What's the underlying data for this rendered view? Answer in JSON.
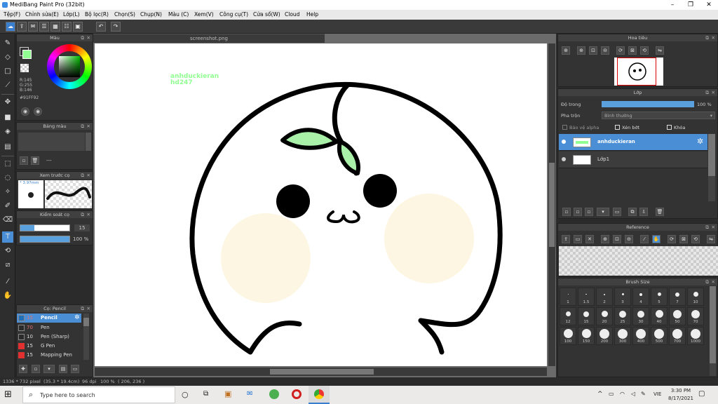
{
  "window": {
    "title": "MediBang Paint Pro (32bit)",
    "minimize": "–",
    "maximize": "❐",
    "close": "✕"
  },
  "menu": [
    "Tệp(F)",
    "Chỉnh sửa(E)",
    "Lớp(L)",
    "Bộ lọc(R)",
    "Chọn(S)",
    "Chụp(N)",
    "Màu (C)",
    "Xem(V)",
    "Công cụ(T)",
    "Cửa sổ(W)",
    "Cloud",
    "Help"
  ],
  "document": {
    "tab": "screenshot.png",
    "canvas_text_1": "anhduckieran",
    "canvas_text_2": "hd247"
  },
  "color_panel": {
    "title": "Màu",
    "r": "R:145",
    "g": "G:255",
    "b": "B:146",
    "hex": "#91FF92",
    "fg_color": "#91ff92",
    "bg_color": "#e8a040"
  },
  "palette_panel": {
    "title": "Bảng màu",
    "empty_label": "---"
  },
  "brush_preview": {
    "title": "Xem trước cọ",
    "size_label": "* 3.97mm"
  },
  "brush_control": {
    "title": "Kiểm soát cọ",
    "size_value": "15",
    "opacity_value": "100 %"
  },
  "brush_list": {
    "title": "Cọ: Pencil",
    "items": [
      {
        "num": "15",
        "name": "Pencil",
        "color": "#1e6fb8",
        "active": true
      },
      {
        "num": "70",
        "name": "Pen",
        "color": "#2a2a2a",
        "active": false
      },
      {
        "num": "10",
        "name": "Pen (Sharp)",
        "color": "#2a2a2a",
        "active": false
      },
      {
        "num": "15",
        "name": "G Pen",
        "color": "#e03030",
        "active": false
      },
      {
        "num": "15",
        "name": "Mapping Pen",
        "color": "#e03030",
        "active": false
      }
    ]
  },
  "navigator": {
    "title": "Hoa tiêu"
  },
  "layer_panel": {
    "title": "Lớp",
    "opacity_label": "Độ trong",
    "opacity_value": "100 %",
    "blend_label": "Pha trộn",
    "blend_value": "Bình thường",
    "protect_alpha": "Bảo vệ alpha",
    "clipping": "Xén bớt",
    "lock": "Khóa",
    "layers": [
      {
        "name": "anhduckieran",
        "selected": true
      },
      {
        "name": "Lớp1",
        "selected": false
      }
    ]
  },
  "reference_panel": {
    "title": "Reference"
  },
  "brush_size_panel": {
    "title": "Brush Size",
    "sizes": [
      "1",
      "1.5",
      "2",
      "3",
      "4",
      "5",
      "7",
      "10",
      "12",
      "15",
      "20",
      "25",
      "30",
      "40",
      "50",
      "70",
      "100",
      "150",
      "200",
      "300",
      "400",
      "500",
      "700",
      "1000"
    ]
  },
  "status": {
    "size": "1336 * 732 pixel",
    "dims": "(35.3 * 19.4cm)",
    "dpi": "96 dpi",
    "zoom": "100 %",
    "coords": "( 206, 236 )"
  },
  "taskbar": {
    "search_placeholder": "Type here to search",
    "lang": "VIE",
    "time": "3:30 PM",
    "date": "8/17/2021"
  }
}
